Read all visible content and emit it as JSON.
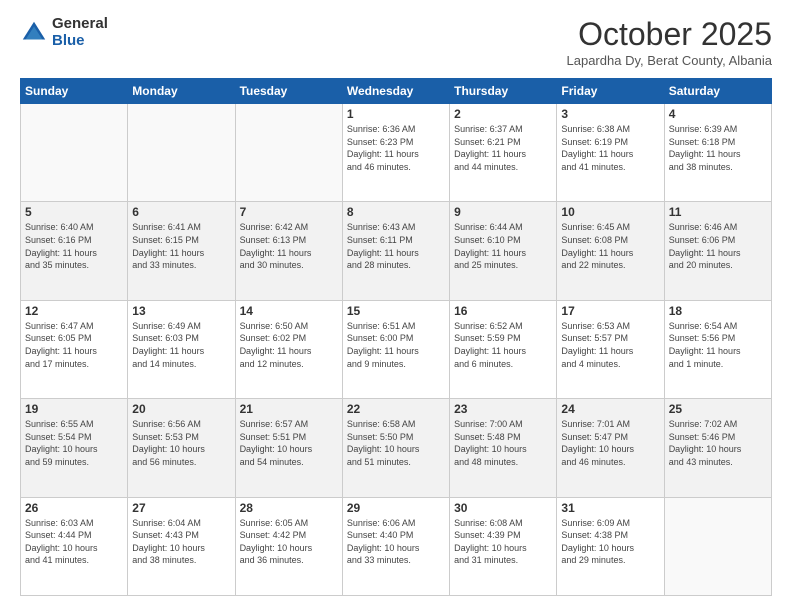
{
  "header": {
    "logo_general": "General",
    "logo_blue": "Blue",
    "title": "October 2025",
    "location": "Lapardha Dy, Berat County, Albania"
  },
  "days_of_week": [
    "Sunday",
    "Monday",
    "Tuesday",
    "Wednesday",
    "Thursday",
    "Friday",
    "Saturday"
  ],
  "weeks": [
    [
      {
        "day": "",
        "info": ""
      },
      {
        "day": "",
        "info": ""
      },
      {
        "day": "",
        "info": ""
      },
      {
        "day": "1",
        "info": "Sunrise: 6:36 AM\nSunset: 6:23 PM\nDaylight: 11 hours\nand 46 minutes."
      },
      {
        "day": "2",
        "info": "Sunrise: 6:37 AM\nSunset: 6:21 PM\nDaylight: 11 hours\nand 44 minutes."
      },
      {
        "day": "3",
        "info": "Sunrise: 6:38 AM\nSunset: 6:19 PM\nDaylight: 11 hours\nand 41 minutes."
      },
      {
        "day": "4",
        "info": "Sunrise: 6:39 AM\nSunset: 6:18 PM\nDaylight: 11 hours\nand 38 minutes."
      }
    ],
    [
      {
        "day": "5",
        "info": "Sunrise: 6:40 AM\nSunset: 6:16 PM\nDaylight: 11 hours\nand 35 minutes."
      },
      {
        "day": "6",
        "info": "Sunrise: 6:41 AM\nSunset: 6:15 PM\nDaylight: 11 hours\nand 33 minutes."
      },
      {
        "day": "7",
        "info": "Sunrise: 6:42 AM\nSunset: 6:13 PM\nDaylight: 11 hours\nand 30 minutes."
      },
      {
        "day": "8",
        "info": "Sunrise: 6:43 AM\nSunset: 6:11 PM\nDaylight: 11 hours\nand 28 minutes."
      },
      {
        "day": "9",
        "info": "Sunrise: 6:44 AM\nSunset: 6:10 PM\nDaylight: 11 hours\nand 25 minutes."
      },
      {
        "day": "10",
        "info": "Sunrise: 6:45 AM\nSunset: 6:08 PM\nDaylight: 11 hours\nand 22 minutes."
      },
      {
        "day": "11",
        "info": "Sunrise: 6:46 AM\nSunset: 6:06 PM\nDaylight: 11 hours\nand 20 minutes."
      }
    ],
    [
      {
        "day": "12",
        "info": "Sunrise: 6:47 AM\nSunset: 6:05 PM\nDaylight: 11 hours\nand 17 minutes."
      },
      {
        "day": "13",
        "info": "Sunrise: 6:49 AM\nSunset: 6:03 PM\nDaylight: 11 hours\nand 14 minutes."
      },
      {
        "day": "14",
        "info": "Sunrise: 6:50 AM\nSunset: 6:02 PM\nDaylight: 11 hours\nand 12 minutes."
      },
      {
        "day": "15",
        "info": "Sunrise: 6:51 AM\nSunset: 6:00 PM\nDaylight: 11 hours\nand 9 minutes."
      },
      {
        "day": "16",
        "info": "Sunrise: 6:52 AM\nSunset: 5:59 PM\nDaylight: 11 hours\nand 6 minutes."
      },
      {
        "day": "17",
        "info": "Sunrise: 6:53 AM\nSunset: 5:57 PM\nDaylight: 11 hours\nand 4 minutes."
      },
      {
        "day": "18",
        "info": "Sunrise: 6:54 AM\nSunset: 5:56 PM\nDaylight: 11 hours\nand 1 minute."
      }
    ],
    [
      {
        "day": "19",
        "info": "Sunrise: 6:55 AM\nSunset: 5:54 PM\nDaylight: 10 hours\nand 59 minutes."
      },
      {
        "day": "20",
        "info": "Sunrise: 6:56 AM\nSunset: 5:53 PM\nDaylight: 10 hours\nand 56 minutes."
      },
      {
        "day": "21",
        "info": "Sunrise: 6:57 AM\nSunset: 5:51 PM\nDaylight: 10 hours\nand 54 minutes."
      },
      {
        "day": "22",
        "info": "Sunrise: 6:58 AM\nSunset: 5:50 PM\nDaylight: 10 hours\nand 51 minutes."
      },
      {
        "day": "23",
        "info": "Sunrise: 7:00 AM\nSunset: 5:48 PM\nDaylight: 10 hours\nand 48 minutes."
      },
      {
        "day": "24",
        "info": "Sunrise: 7:01 AM\nSunset: 5:47 PM\nDaylight: 10 hours\nand 46 minutes."
      },
      {
        "day": "25",
        "info": "Sunrise: 7:02 AM\nSunset: 5:46 PM\nDaylight: 10 hours\nand 43 minutes."
      }
    ],
    [
      {
        "day": "26",
        "info": "Sunrise: 6:03 AM\nSunset: 4:44 PM\nDaylight: 10 hours\nand 41 minutes."
      },
      {
        "day": "27",
        "info": "Sunrise: 6:04 AM\nSunset: 4:43 PM\nDaylight: 10 hours\nand 38 minutes."
      },
      {
        "day": "28",
        "info": "Sunrise: 6:05 AM\nSunset: 4:42 PM\nDaylight: 10 hours\nand 36 minutes."
      },
      {
        "day": "29",
        "info": "Sunrise: 6:06 AM\nSunset: 4:40 PM\nDaylight: 10 hours\nand 33 minutes."
      },
      {
        "day": "30",
        "info": "Sunrise: 6:08 AM\nSunset: 4:39 PM\nDaylight: 10 hours\nand 31 minutes."
      },
      {
        "day": "31",
        "info": "Sunrise: 6:09 AM\nSunset: 4:38 PM\nDaylight: 10 hours\nand 29 minutes."
      },
      {
        "day": "",
        "info": ""
      }
    ]
  ]
}
